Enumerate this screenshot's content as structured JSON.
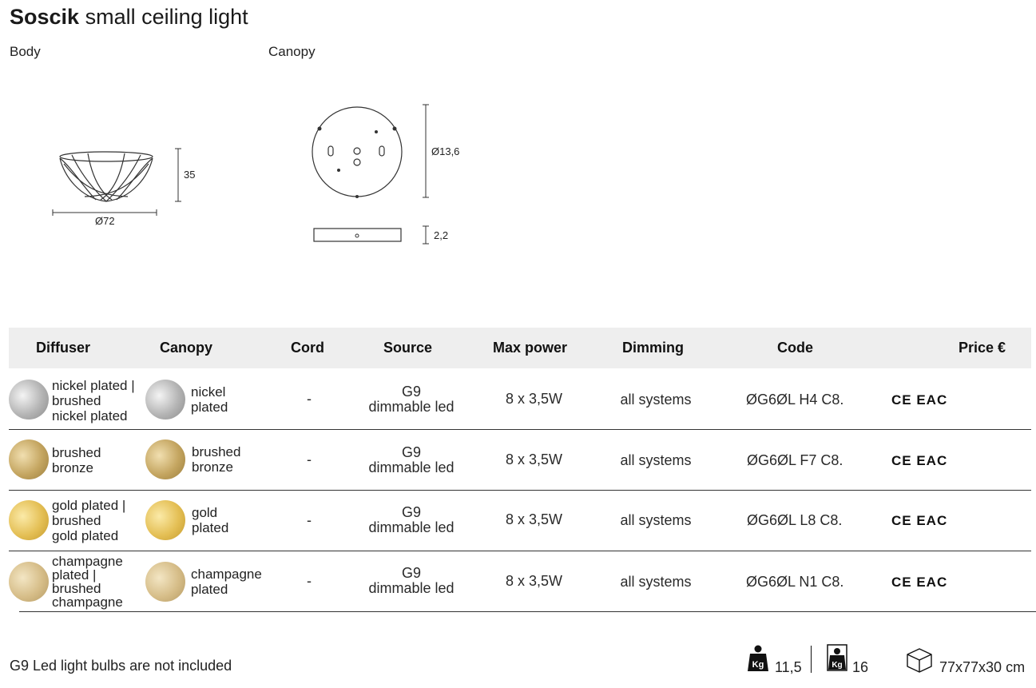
{
  "product": {
    "name": "Soscik",
    "subtitle": "small ceiling light"
  },
  "drawings": {
    "body_label": "Body",
    "canopy_label": "Canopy",
    "body_height": "35",
    "body_diameter": "Ø72",
    "canopy_diameter": "Ø13,6",
    "canopy_height": "2,2"
  },
  "table": {
    "headers": {
      "diffuser": "Diffuser",
      "canopy": "Canopy",
      "cord": "Cord",
      "source": "Source",
      "max_power": "Max power",
      "dimming": "Dimming",
      "code": "Code",
      "price": "Price €"
    },
    "rows": [
      {
        "diffuser": [
          "nickel plated |",
          "brushed",
          "nickel plated"
        ],
        "diffuser_color": "#c6c6c6",
        "canopy": [
          "nickel",
          "plated"
        ],
        "canopy_color": "#c6c6c6",
        "cord": "-",
        "source": [
          "G9",
          "dimmable led"
        ],
        "max_power": "8 x 3,5W",
        "dimming": "all systems",
        "code": "ØG6ØL H4 C8.",
        "cert": "CE EAC"
      },
      {
        "diffuser": [
          "brushed",
          "bronze"
        ],
        "diffuser_color": "#c9ad6e",
        "canopy": [
          "brushed",
          "bronze"
        ],
        "canopy_color": "#c9ad6e",
        "cord": "-",
        "source": [
          "G9",
          "dimmable led"
        ],
        "max_power": "8 x 3,5W",
        "dimming": "all systems",
        "code": "ØG6ØL F7 C8.",
        "cert": "CE EAC"
      },
      {
        "diffuser": [
          "gold plated |",
          "brushed",
          "gold plated"
        ],
        "diffuser_color": "#e6c25c",
        "canopy": [
          "gold",
          "plated"
        ],
        "canopy_color": "#e6c25c",
        "cord": "-",
        "source": [
          "G9",
          "dimmable led"
        ],
        "max_power": "8 x 3,5W",
        "dimming": "all systems",
        "code": "ØG6ØL L8 C8.",
        "cert": "CE EAC"
      },
      {
        "diffuser": [
          "champagne",
          "plated |",
          "brushed",
          "champagne"
        ],
        "diffuser_color": "#d9c08c",
        "canopy": [
          "champagne",
          "plated"
        ],
        "canopy_color": "#d9c08c",
        "cord": "-",
        "source": [
          "G9",
          "dimmable led"
        ],
        "max_power": "8 x 3,5W",
        "dimming": "all systems",
        "code": "ØG6ØL N1 C8.",
        "cert": "CE EAC"
      }
    ]
  },
  "footer": {
    "note": "G9 Led light bulbs are not included",
    "net_weight": "11,5",
    "gross_weight": "16",
    "package_size": "77x77x30 cm",
    "weight_icon_text": "Kg"
  }
}
